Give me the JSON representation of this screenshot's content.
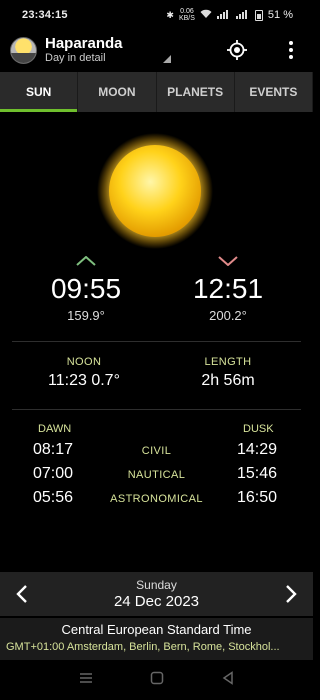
{
  "status": {
    "time": "23:34:15",
    "net_speed_top": "0.06",
    "net_speed_bottom": "KB/S",
    "battery": "51 %"
  },
  "app": {
    "title": "Haparanda",
    "subtitle": "Day in detail"
  },
  "tabs": [
    {
      "label": "SUN",
      "active": true
    },
    {
      "label": "MOON",
      "active": false
    },
    {
      "label": "PLANETS",
      "active": false
    },
    {
      "label": "EVENTS",
      "active": false
    }
  ],
  "sun": {
    "rise": {
      "time": "09:55",
      "azimuth": "159.9°"
    },
    "set": {
      "time": "12:51",
      "azimuth": "200.2°"
    },
    "noon": {
      "label": "NOON",
      "value": "11:23  0.7°"
    },
    "length": {
      "label": "LENGTH",
      "value": "2h 56m"
    }
  },
  "twilight": {
    "dawn_label": "DAWN",
    "dusk_label": "DUSK",
    "rows": [
      {
        "name": "CIVIL",
        "dawn": "08:17",
        "dusk": "14:29"
      },
      {
        "name": "NAUTICAL",
        "dawn": "07:00",
        "dusk": "15:46"
      },
      {
        "name": "ASTRONOMICAL",
        "dawn": "05:56",
        "dusk": "16:50"
      }
    ]
  },
  "date": {
    "weekday": "Sunday",
    "date": "24 Dec 2023"
  },
  "timezone": {
    "name": "Central European Standard Time",
    "detail": "GMT+01:00 Amsterdam, Berlin, Bern, Rome, Stockhol..."
  },
  "colors": {
    "accent": "#6fbf2d",
    "label": "#d6e29a",
    "rise_arrow": "#7fbf7f",
    "set_arrow": "#e08a8a"
  }
}
